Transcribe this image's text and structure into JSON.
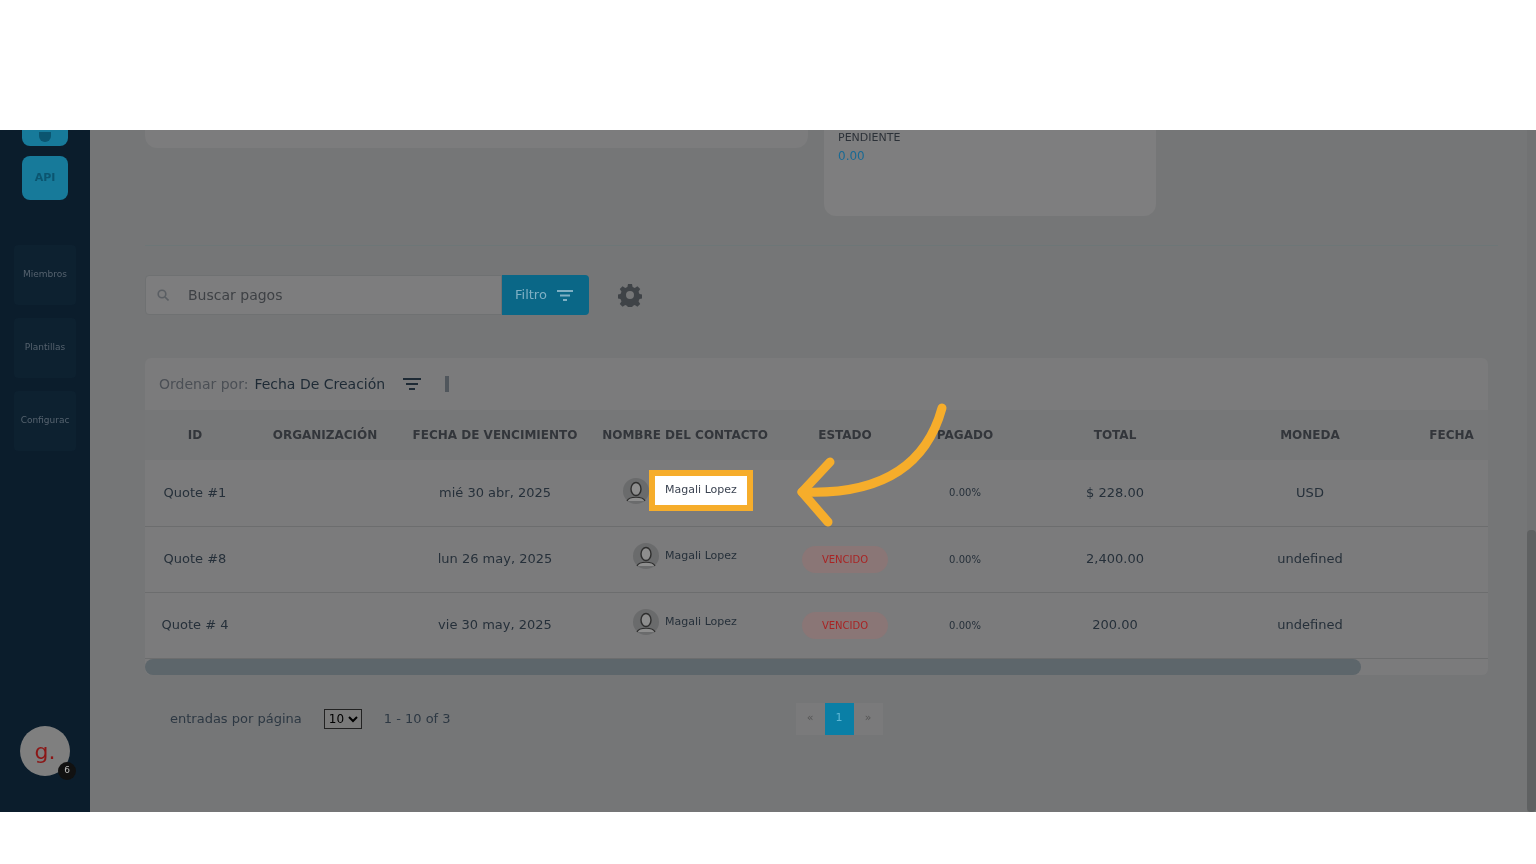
{
  "sidebar": {
    "items": [
      {
        "kind": "icon"
      },
      {
        "kind": "icon",
        "label": "API"
      },
      {
        "kind": "text",
        "label": "Miembros"
      },
      {
        "kind": "text",
        "label": "Plantillas"
      },
      {
        "kind": "text",
        "label": "Configurac"
      }
    ],
    "user": {
      "initial": "g.",
      "badge": "6"
    }
  },
  "summary": {
    "label": "PENDIENTE",
    "value": "0.00"
  },
  "toolbar": {
    "search": {
      "placeholder": "Buscar pagos"
    },
    "filter_button": "Filtro"
  },
  "sort": {
    "label": "Ordenar por:",
    "value": "Fecha De Creación"
  },
  "table": {
    "columns": [
      "ID",
      "ORGANIZACIÓN",
      "FECHA DE VENCIMIENTO",
      "NOMBRE DEL CONTACTO",
      "ESTADO",
      "PAGADO",
      "TOTAL",
      "MONEDA",
      "FECHA"
    ],
    "rows": [
      {
        "id": "Quote #1",
        "vencimiento": "mié 30 abr, 2025",
        "contacto": "Magali Lopez",
        "highlighted": true,
        "pagado": "0.00%",
        "total": "$ 228.00",
        "moneda": "USD"
      },
      {
        "id": "Quote #8",
        "vencimiento": "lun 26 may, 2025",
        "contacto": "Magali Lopez",
        "highlighted": false,
        "estado": "VENCIDO",
        "pagado": "0.00%",
        "total": "2,400.00",
        "moneda": "undefined"
      },
      {
        "id": "Quote # 4",
        "vencimiento": "vie 30 may, 2025",
        "contacto": "Magali Lopez",
        "highlighted": false,
        "estado": "VENCIDO",
        "pagado": "0.00%",
        "total": "200.00",
        "moneda": "undefined"
      }
    ]
  },
  "footer": {
    "per_page_label": "entradas por página",
    "per_page": "10",
    "range": "1 - 10 of 3",
    "pages": [
      {
        "label": "«",
        "selected": false
      },
      {
        "label": "1",
        "selected": true
      },
      {
        "label": "»",
        "selected": false
      }
    ]
  }
}
